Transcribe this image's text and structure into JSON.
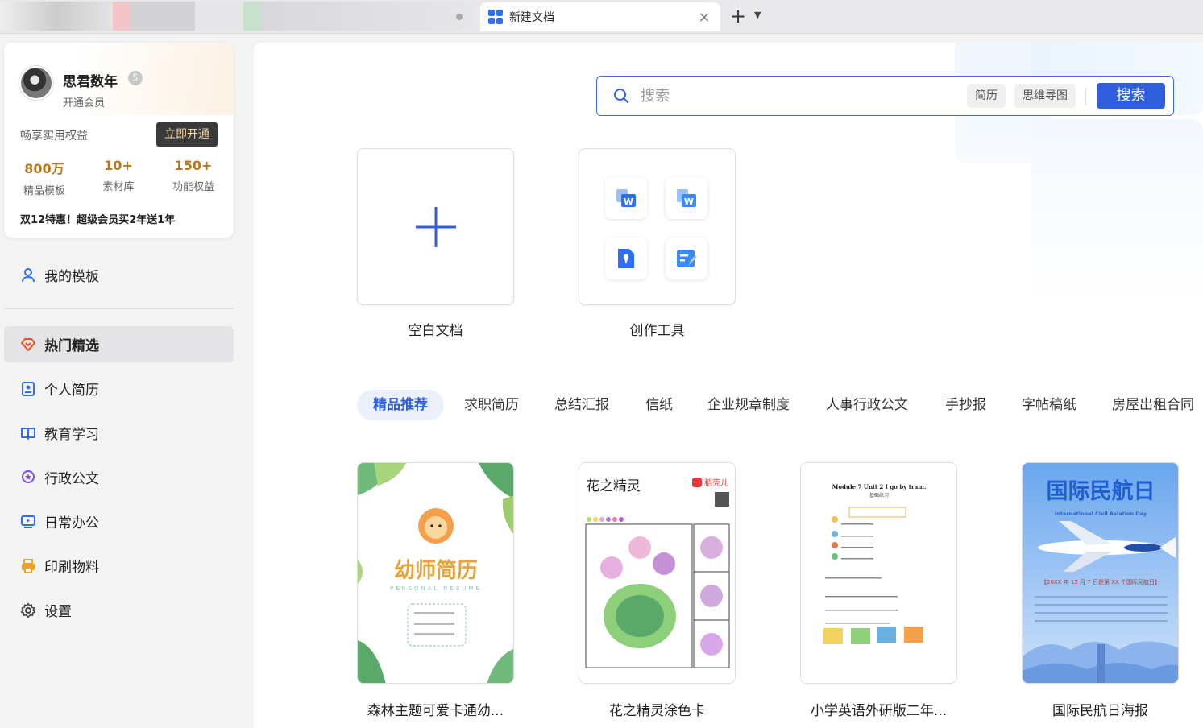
{
  "tabs": {
    "active_title": "新建文档"
  },
  "profile": {
    "username": "思君数年",
    "member_link": "开通会员",
    "benefit_label": "畅享实用权益",
    "open_button": "立即开通",
    "stats": [
      {
        "value": "800万",
        "label": "精品模板"
      },
      {
        "value": "10+",
        "label": "素材库"
      },
      {
        "value": "150+",
        "label": "功能权益"
      }
    ],
    "promo": "双12特惠！超级会员买2年送1年"
  },
  "nav": {
    "my_templates": "我的模板",
    "items": [
      {
        "label": "热门精选",
        "icon": "heart-diamond-icon"
      },
      {
        "label": "个人简历",
        "icon": "resume-icon"
      },
      {
        "label": "教育学习",
        "icon": "book-icon"
      },
      {
        "label": "行政公文",
        "icon": "badge-icon"
      },
      {
        "label": "日常办公",
        "icon": "monitor-icon"
      },
      {
        "label": "印刷物料",
        "icon": "printer-icon"
      },
      {
        "label": "设置",
        "icon": "gear-icon"
      }
    ]
  },
  "search": {
    "placeholder": "搜索",
    "tags": [
      "简历",
      "思维导图"
    ],
    "button": "搜索"
  },
  "create": {
    "blank_label": "空白文档",
    "tools_label": "创作工具"
  },
  "categories": [
    "精品推荐",
    "求职简历",
    "总结汇报",
    "信纸",
    "企业规章制度",
    "人事行政公文",
    "手抄报",
    "字帖稿纸",
    "房屋出租合同"
  ],
  "templates": [
    {
      "title": "森林主题可爱卡通幼...",
      "heading": "幼师简历",
      "sub": "PERSONAL RESUME"
    },
    {
      "title": "花之精灵涂色卡",
      "heading": "花之精灵",
      "brand": "稻壳儿"
    },
    {
      "title": "小学英语外研版二年...",
      "heading": "Module 7 Unit 2 I go by train.",
      "sub": "基础练习"
    },
    {
      "title": "国际民航日海报",
      "heading": "国际民航日",
      "sub": "International Civil Aviation Day",
      "banner": "【20XX 年 12 月 7 日是第 XX 个国际民航日】"
    }
  ],
  "colors": {
    "accent": "#2f5fde",
    "gold": "#b8791c"
  }
}
